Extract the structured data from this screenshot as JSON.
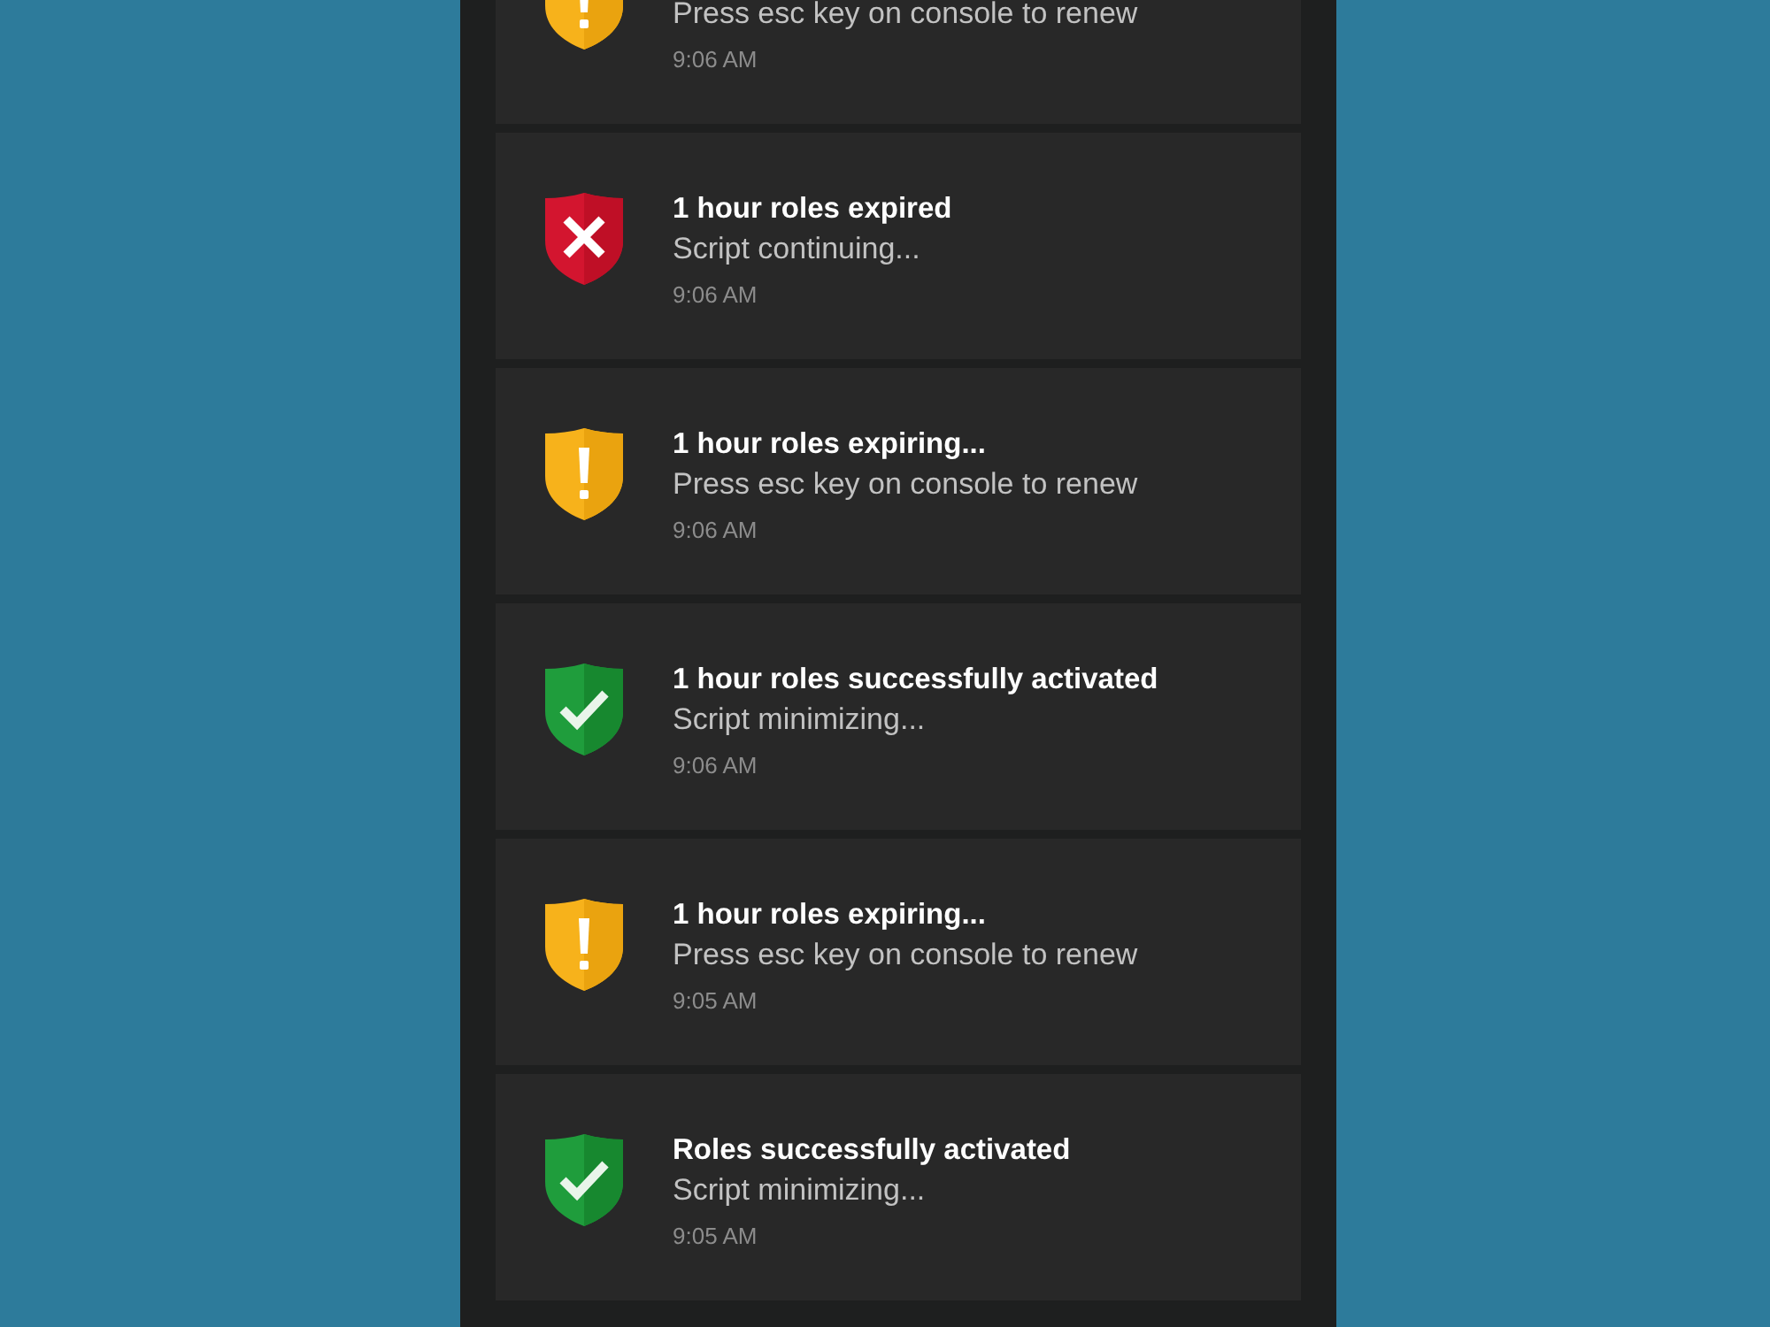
{
  "notifications": [
    {
      "kind": "warning",
      "message": "Press esc key on console to renew",
      "time": "9:06 AM"
    },
    {
      "kind": "error",
      "title": "1 hour roles expired",
      "message": "Script continuing...",
      "time": "9:06 AM"
    },
    {
      "kind": "warning",
      "title": "1 hour roles expiring...",
      "message": "Press esc key on console to renew",
      "time": "9:06 AM"
    },
    {
      "kind": "success",
      "title": "1 hour roles successfully activated",
      "message": "Script minimizing...",
      "time": "9:06 AM"
    },
    {
      "kind": "warning",
      "title": "1 hour roles expiring...",
      "message": "Press esc key on console to renew",
      "time": "9:05 AM"
    },
    {
      "kind": "success",
      "title": "Roles successfully activated",
      "message": "Script minimizing...",
      "time": "9:05 AM"
    }
  ]
}
